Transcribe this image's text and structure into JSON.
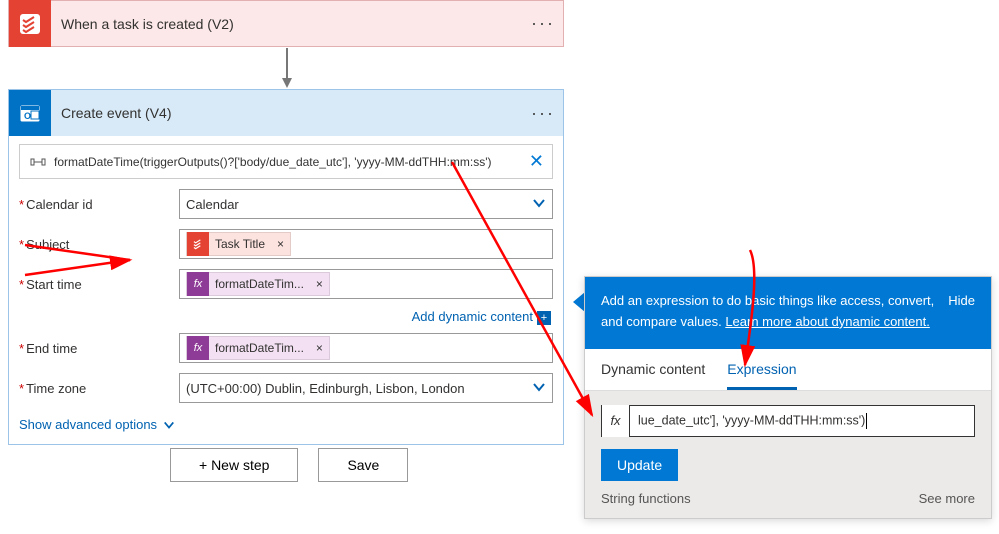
{
  "trigger": {
    "title": "When a task is created (V2)"
  },
  "action": {
    "title": "Create event (V4)",
    "expression_preview": "formatDateTime(triggerOutputs()?['body/due_date_utc'], 'yyyy-MM-ddTHH:mm:ss')",
    "rows": {
      "calendar_label": "Calendar id",
      "calendar_value": "Calendar",
      "subject_label": "Subject",
      "subject_token": "Task Title",
      "start_label": "Start time",
      "start_token": "formatDateTim...",
      "end_label": "End time",
      "end_token": "formatDateTim...",
      "tz_label": "Time zone",
      "tz_value": "(UTC+00:00) Dublin, Edinburgh, Lisbon, London"
    },
    "add_dynamic": "Add dynamic content",
    "advanced": "Show advanced options"
  },
  "footer": {
    "new_step": "+ New step",
    "save": "Save"
  },
  "popup": {
    "help": "Add an expression to do basic things like access, convert, and compare values.",
    "learn_more": "Learn more about dynamic content.",
    "hide": "Hide",
    "tab_dynamic": "Dynamic content",
    "tab_expression": "Expression",
    "fx_label": "fx",
    "expr_value": "lue_date_utc'], 'yyyy-MM-ddTHH:mm:ss')",
    "update": "Update",
    "section": "String functions",
    "see_more": "See more"
  },
  "token_x": "×"
}
